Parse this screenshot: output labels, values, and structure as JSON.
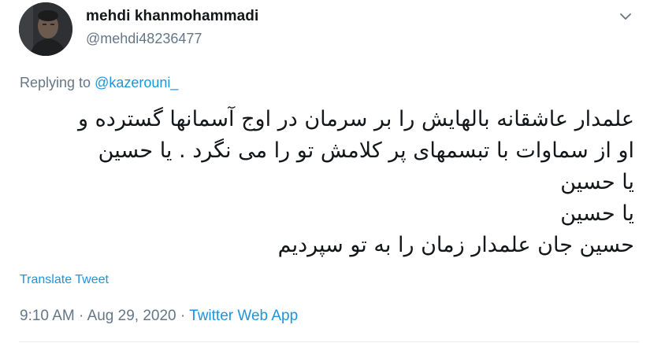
{
  "author": {
    "display_name": "mehdi khanmohammadi",
    "handle": "@mehdi48236477"
  },
  "reply": {
    "prefix": "Replying to",
    "mention": "@kazerouni_"
  },
  "tweet": {
    "lines": [
      "علمدار عاشقانه بالهایش را بر سرمان در اوج آسمانها گسترده و",
      "او از سماوات با تبسمهای  پر کلامش تو را می نگرد . یا حسین",
      "یا حسین",
      "یا حسین",
      "حسین جان علمدار زمان را  به تو سپردیم"
    ]
  },
  "translate_label": "Translate Tweet",
  "meta": {
    "time": "9:10 AM",
    "separator": "·",
    "date": "Aug 29, 2020",
    "source": "Twitter Web App"
  },
  "icons": {
    "caret": "chevron-down-icon",
    "avatar": "profile-photo"
  },
  "colors": {
    "accent": "#1b95e0",
    "muted": "#657786",
    "text": "#14171a",
    "divider": "#e6ecf0"
  }
}
